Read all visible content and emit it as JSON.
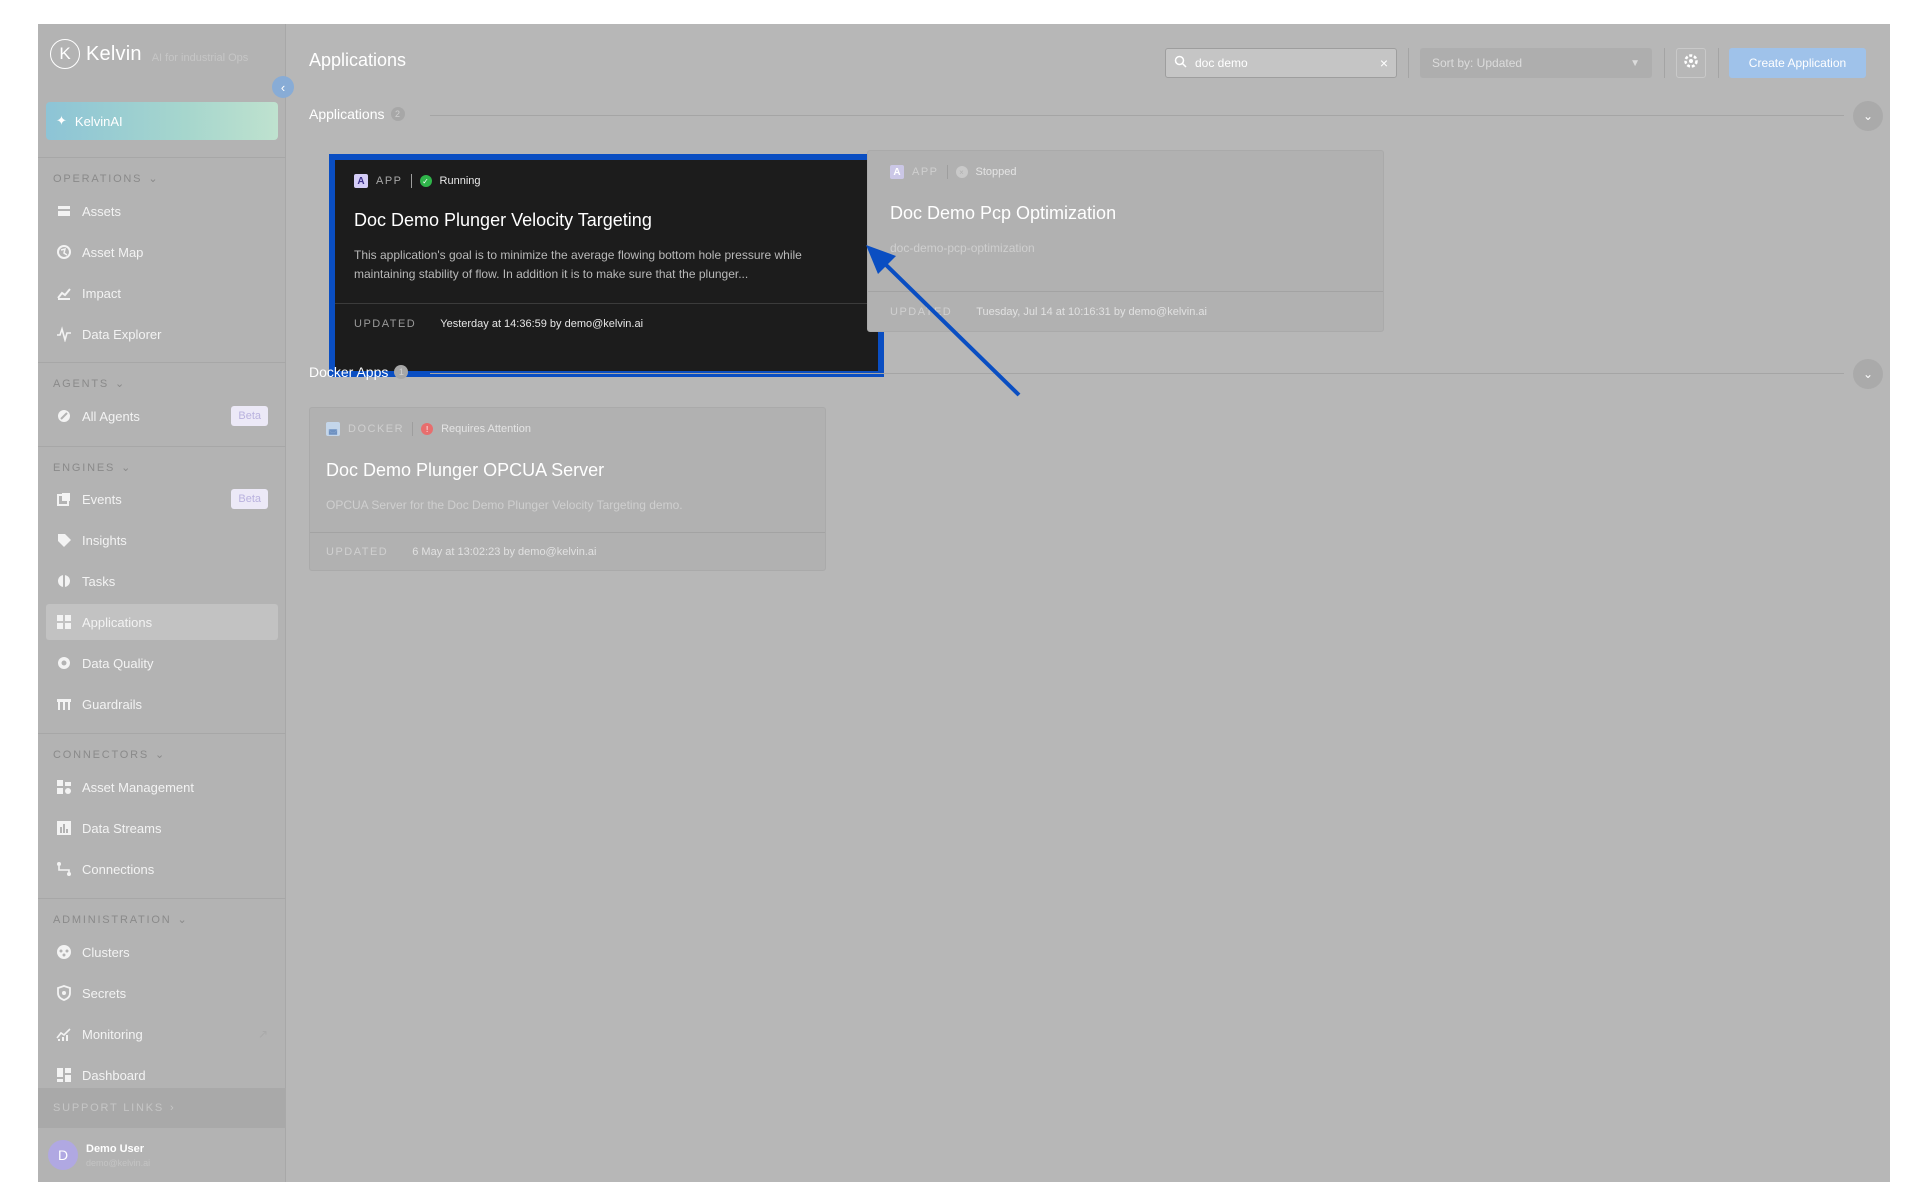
{
  "brand": {
    "name": "Kelvin",
    "subtitle": "AI for industrial Ops"
  },
  "kelvinai": {
    "label": "KelvinAI"
  },
  "sidebar": {
    "sections": {
      "operations": "OPERATIONS",
      "agents": "AGENTS",
      "engines": "ENGINES",
      "connectors": "CONNECTORS",
      "administration": "ADMINISTRATION",
      "support": "SUPPORT LINKS"
    },
    "items": {
      "assets": "Assets",
      "asset_map": "Asset Map",
      "impact": "Impact",
      "data_explorer": "Data Explorer",
      "all_agents": "All Agents",
      "events": "Events",
      "insights": "Insights",
      "tasks": "Tasks",
      "applications": "Applications",
      "data_quality": "Data Quality",
      "guardrails": "Guardrails",
      "asset_management": "Asset Management",
      "data_streams": "Data Streams",
      "connections": "Connections",
      "clusters": "Clusters",
      "secrets": "Secrets",
      "monitoring": "Monitoring",
      "dashboard": "Dashboard"
    },
    "beta_label": "Beta",
    "active": "Applications"
  },
  "user": {
    "initial": "D",
    "name": "Demo User",
    "email": "demo@kelvin.ai"
  },
  "header": {
    "title": "Applications",
    "search_value": "doc demo",
    "sort_label": "Sort by: Updated",
    "create_label": "Create Application"
  },
  "sections": [
    {
      "title": "Applications",
      "count": "2"
    },
    {
      "title": "Docker Apps",
      "count": "1"
    }
  ],
  "cards": [
    {
      "type_letter": "A",
      "type": "APP",
      "status": "Running",
      "title": "Doc Demo Plunger Velocity Targeting",
      "description": "This application's goal is to minimize the average flowing bottom hole pressure while maintaining stability of flow. In addition it is to make sure that the plunger...",
      "updated_label": "UPDATED",
      "updated": "Yesterday at 14:36:59 by demo@kelvin.ai"
    },
    {
      "type_letter": "A",
      "type": "APP",
      "status": "Stopped",
      "title": "Doc Demo Pcp Optimization",
      "description": "doc-demo-pcp-optimization",
      "updated_label": "UPDATED",
      "updated": "Tuesday, Jul 14 at 10:16:31 by demo@kelvin.ai"
    },
    {
      "type_letter": "",
      "type": "DOCKER",
      "status": "Requires Attention",
      "title": "Doc Demo Plunger OPCUA Server",
      "description": "OPCUA Server for the Doc Demo Plunger Velocity Targeting demo.",
      "updated_label": "UPDATED",
      "updated": "6 May at 13:02:23 by demo@kelvin.ai"
    }
  ],
  "colors": {
    "highlight_border": "#0a4ec2",
    "arrow": "#0a4ec2",
    "running": "#2fb54a",
    "stopped": "#c9c9c9",
    "attention": "#e86e6e",
    "primary_button": "#9fc2ea"
  }
}
